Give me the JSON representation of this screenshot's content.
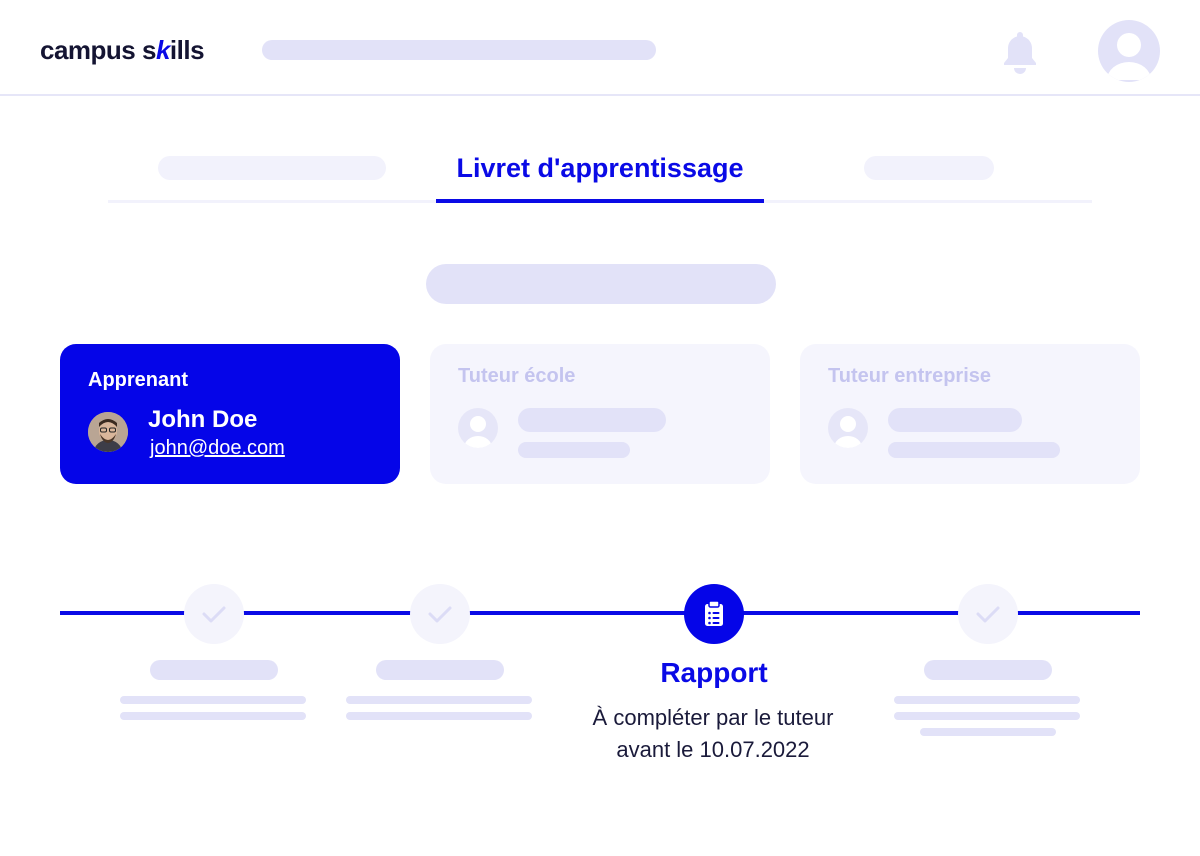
{
  "brand": {
    "logo_text_a": "campus s",
    "logo_text_tick": "k",
    "logo_text_b": "ills"
  },
  "tabs": {
    "active_label": "Livret d'apprentissage"
  },
  "cards": [
    {
      "title": "Apprenant",
      "name": "John Doe",
      "email": "john@doe.com"
    },
    {
      "title": "Tuteur école"
    },
    {
      "title": "Tuteur entreprise"
    }
  ],
  "timeline": {
    "active_step": {
      "title": "Rapport",
      "description": "À compléter par le tuteur avant le 10.07.2022"
    }
  },
  "colors": {
    "accent": "#0a0ae6",
    "placeholder": "#e2e2f8",
    "muted_card": "#f5f5fd"
  },
  "icons": [
    "bell-icon",
    "user-avatar-icon",
    "check-icon",
    "clipboard-list-icon"
  ]
}
